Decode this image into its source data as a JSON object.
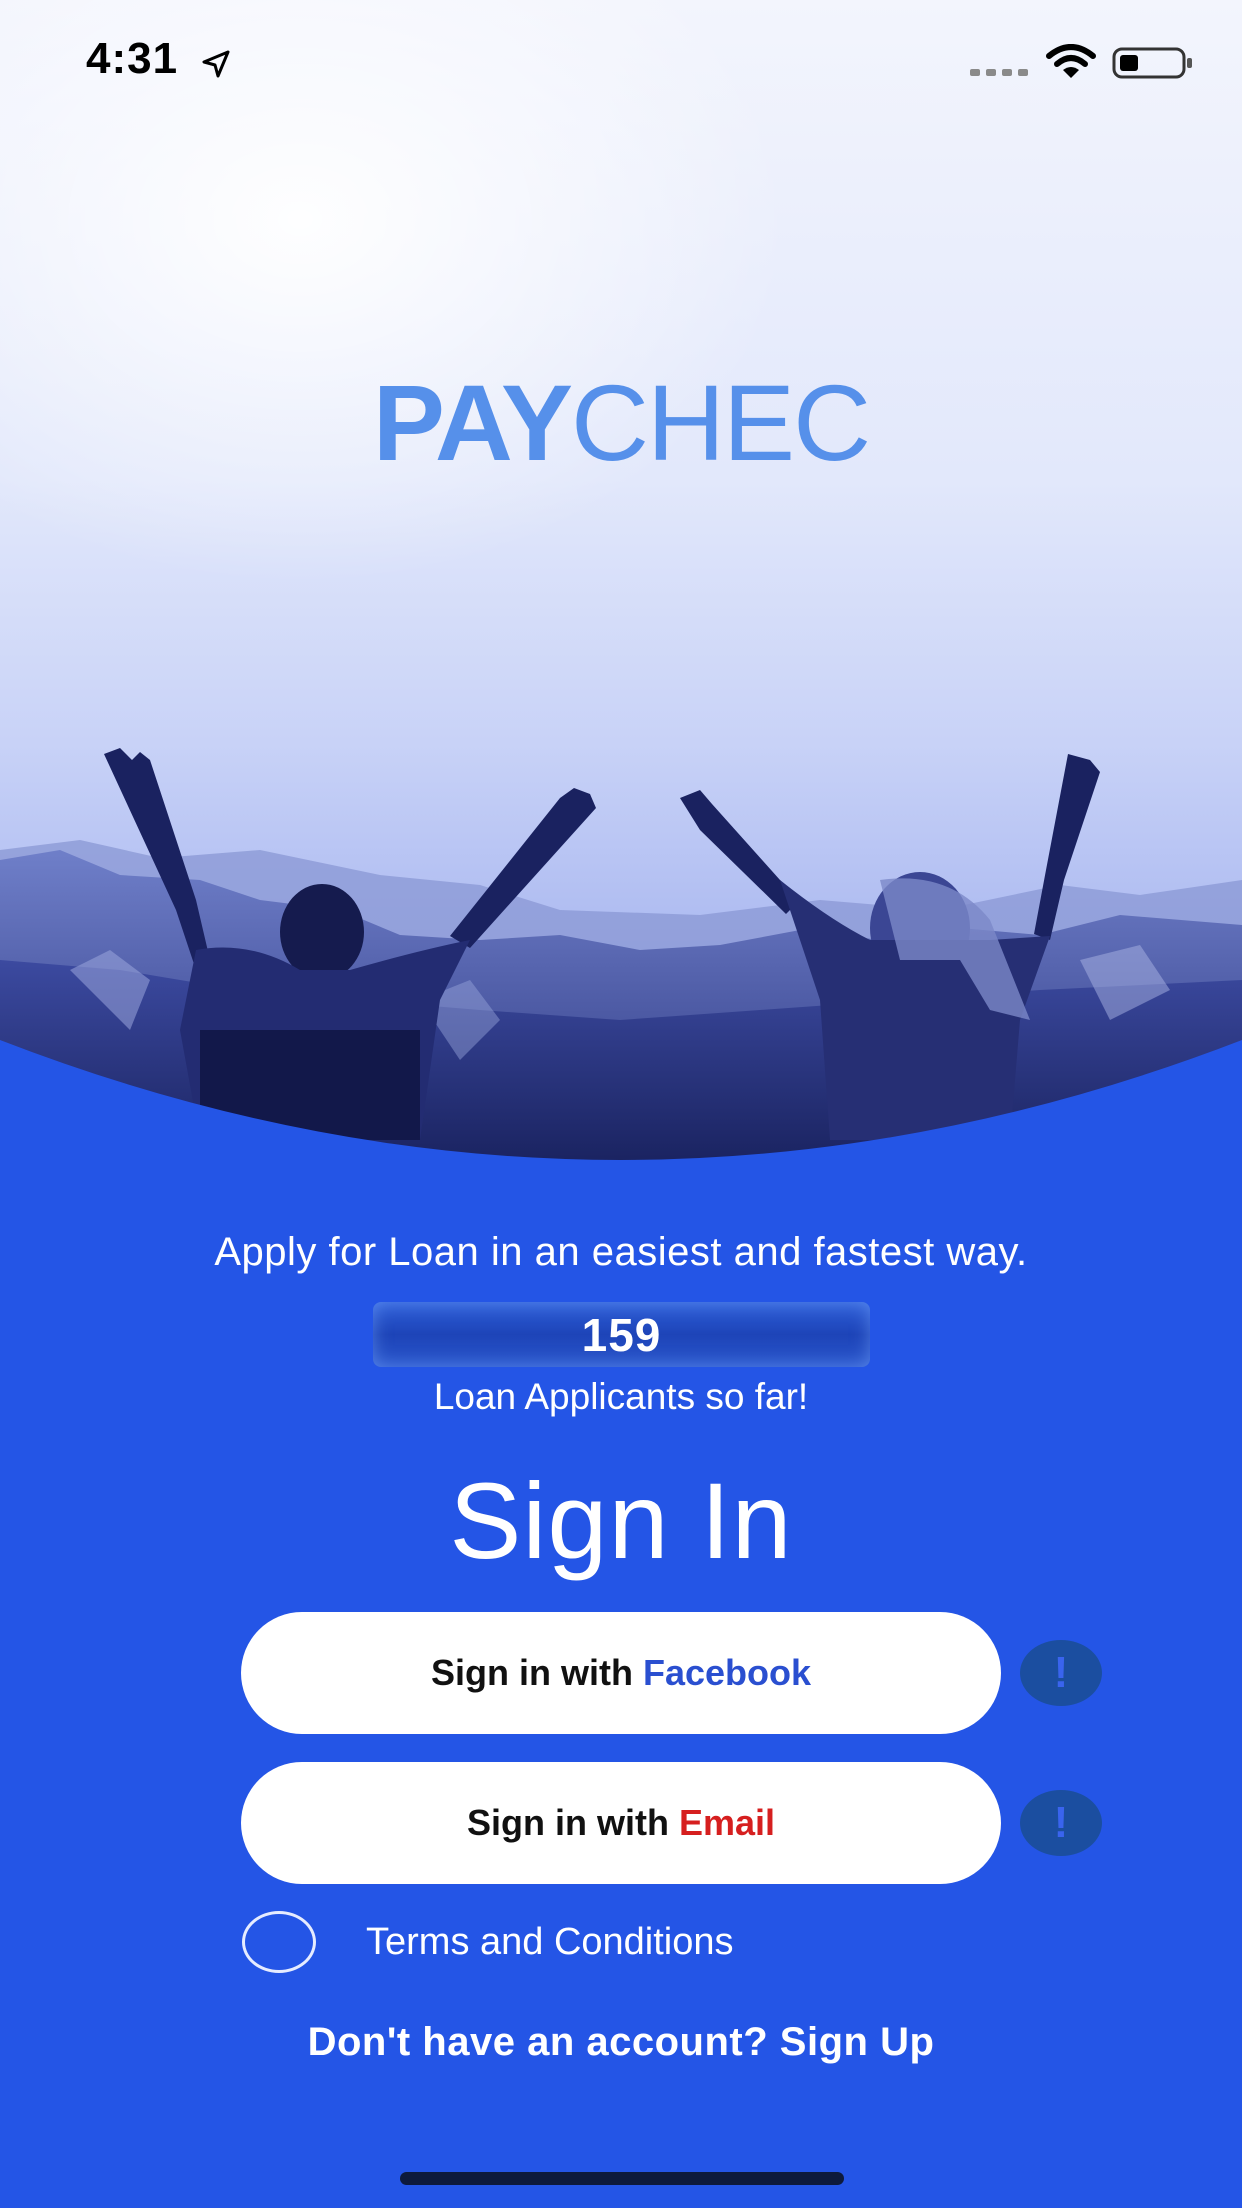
{
  "status_bar": {
    "time": "4:31",
    "location_icon": "location-arrow-icon",
    "signal_icon": "cellular-signal-icon",
    "wifi_icon": "wifi-icon",
    "battery_icon": "battery-icon"
  },
  "logo": {
    "bold": "PAY",
    "light": "CHEC"
  },
  "tagline": "Apply for Loan in an easiest and fastest way.",
  "counter": {
    "value": "159",
    "caption": "Loan Applicants so far!"
  },
  "sign_in": {
    "title": "Sign In",
    "facebook": {
      "prefix": "Sign in with",
      "provider": "Facebook",
      "info_glyph": "!"
    },
    "email": {
      "prefix": "Sign in with",
      "provider": "Email",
      "info_glyph": "!"
    }
  },
  "terms": {
    "label": "Terms and Conditions",
    "checked": false
  },
  "signup": {
    "text": "Don't have an account? Sign Up"
  },
  "colors": {
    "primary_blue": "#2455e6",
    "logo_blue": "#5690ea",
    "facebook_blue": "#2a4fd0",
    "email_red": "#d61f1f",
    "info_button": "#1b4ea0"
  }
}
